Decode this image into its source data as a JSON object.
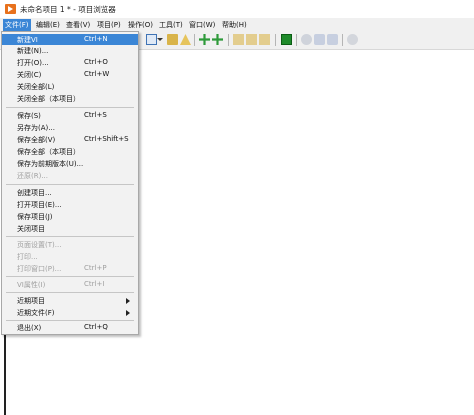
{
  "window": {
    "title": "未命名项目 1 * - 项目浏览器"
  },
  "menubar": [
    {
      "label": "文件(F)",
      "active": true
    },
    {
      "label": "编辑(E)"
    },
    {
      "label": "查看(V)"
    },
    {
      "label": "项目(P)"
    },
    {
      "label": "操作(O)"
    },
    {
      "label": "工具(T)"
    },
    {
      "label": "窗口(W)"
    },
    {
      "label": "帮助(H)"
    }
  ],
  "file_menu": [
    {
      "label": "新建VI",
      "shortcut": "Ctrl+N"
    },
    {
      "label": "新建(N)..."
    },
    {
      "label": "打开(O)...",
      "shortcut": "Ctrl+O"
    },
    {
      "label": "关闭(C)",
      "shortcut": "Ctrl+W"
    },
    {
      "label": "关闭全部(L)"
    },
    {
      "label": "关闭全部（本项目）"
    },
    {
      "label": "保存(S)",
      "shortcut": "Ctrl+S"
    },
    {
      "label": "另存为(A)..."
    },
    {
      "label": "保存全部(V)",
      "shortcut": "Ctrl+Shift+S"
    },
    {
      "label": "保存全部（本项目）"
    },
    {
      "label": "保存为前期版本(U)..."
    },
    {
      "label": "还原(R)..."
    },
    {
      "label": "创建项目..."
    },
    {
      "label": "打开项目(E)..."
    },
    {
      "label": "保存项目(J)"
    },
    {
      "label": "关闭项目"
    },
    {
      "label": "页面设置(T)..."
    },
    {
      "label": "打印..."
    },
    {
      "label": "打印窗口(P)...",
      "shortcut": "Ctrl+P"
    },
    {
      "label": "VI属性(I)",
      "shortcut": "Ctrl+I"
    },
    {
      "label": "近期项目"
    },
    {
      "label": "近期文件(F)"
    },
    {
      "label": "退出(X)",
      "shortcut": "Ctrl+Q"
    }
  ],
  "colors": {
    "highlight": "#3b86d6",
    "menu_bg": "#f2f2f2",
    "disabled_text": "#a0a0a0",
    "app_icon": "#e8711c"
  }
}
